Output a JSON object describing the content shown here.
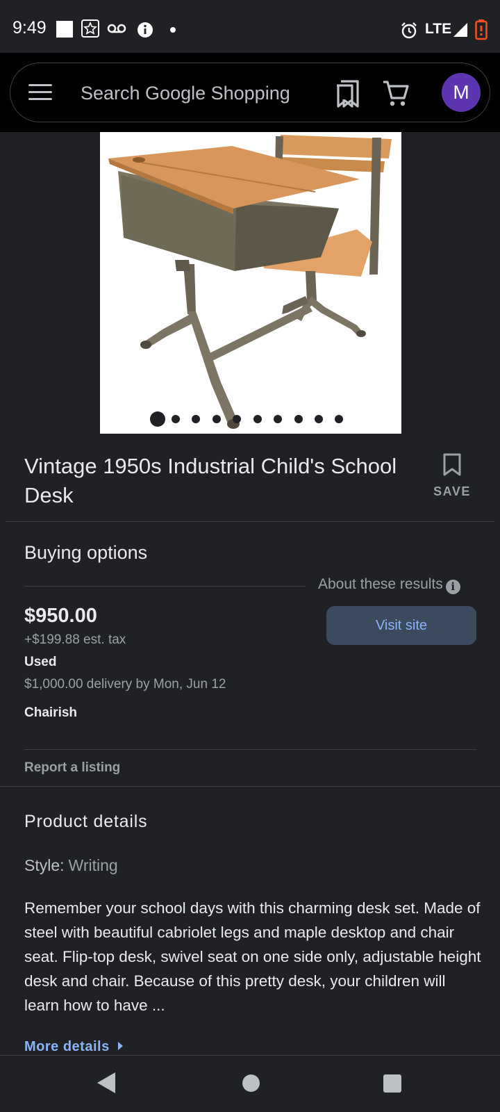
{
  "status_bar": {
    "time": "9:49",
    "network": "LTE",
    "icons": [
      "white-square-icon",
      "star-notification-icon",
      "voicemail-icon",
      "info-icon",
      "dot-icon",
      "alarm-icon",
      "signal-icon",
      "battery-icon"
    ]
  },
  "header": {
    "search_placeholder": "Search Google Shopping",
    "avatar_letter": "M",
    "colors": {
      "avatar": "#5e35b1"
    }
  },
  "carousel": {
    "image_count": 10,
    "active_index": 0
  },
  "product": {
    "title": "Vintage 1950s Industrial Child's School Desk",
    "save_label": "SAVE"
  },
  "buying_options": {
    "heading": "Buying options",
    "about_results": "About these results",
    "price": "$950.00",
    "tax": "+$199.88 est. tax",
    "condition": "Used",
    "delivery": "$1,000.00 delivery by Mon, Jun 12",
    "merchant": "Chairish",
    "visit_label": "Visit site",
    "report_label": "Report a listing"
  },
  "product_details": {
    "heading": "Product details",
    "style_key": "Style:",
    "style_value": "Writing",
    "description": "Remember your school days with this charming desk set. Made of steel with beautiful cabriolet legs and maple desktop and chair seat. Flip-top desk, swivel seat on one side only, adjustable height desk and chair. Because of this pretty desk, your children will learn how to have ...",
    "more_label": "More details"
  },
  "colors": {
    "background": "#202124",
    "link": "#8ab4f8",
    "button_bg": "#3c4a5e"
  }
}
